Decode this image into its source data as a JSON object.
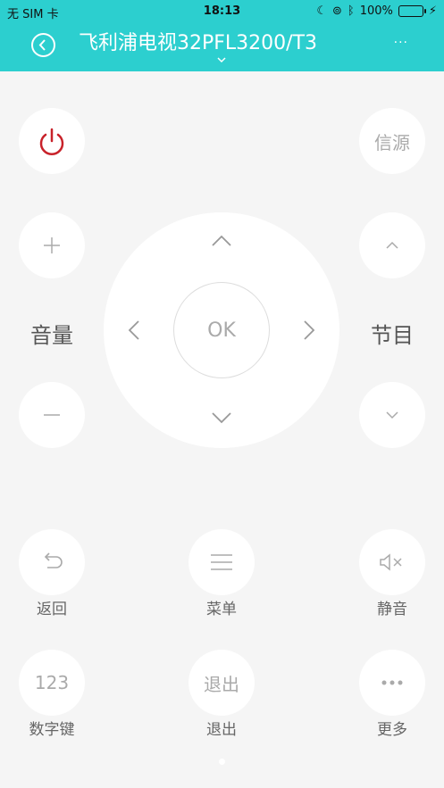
{
  "status_bar": {
    "carrier": "无 SIM 卡",
    "time": "18:13",
    "battery": "100%"
  },
  "header": {
    "title": "飞利浦电视32PFL3200/T3",
    "more": "..."
  },
  "controls": {
    "source_label": "信源",
    "volume_label": "音量",
    "channel_label": "节目",
    "ok_label": "OK",
    "back_label": "返回",
    "menu_label": "菜单",
    "mute_label": "静音",
    "numpad_button": "123",
    "numpad_label": "数字键",
    "exit_button": "退出",
    "exit_label": "退出",
    "more_label": "更多"
  },
  "colors": {
    "header": "#2ccfcf",
    "power": "#c8222a"
  }
}
